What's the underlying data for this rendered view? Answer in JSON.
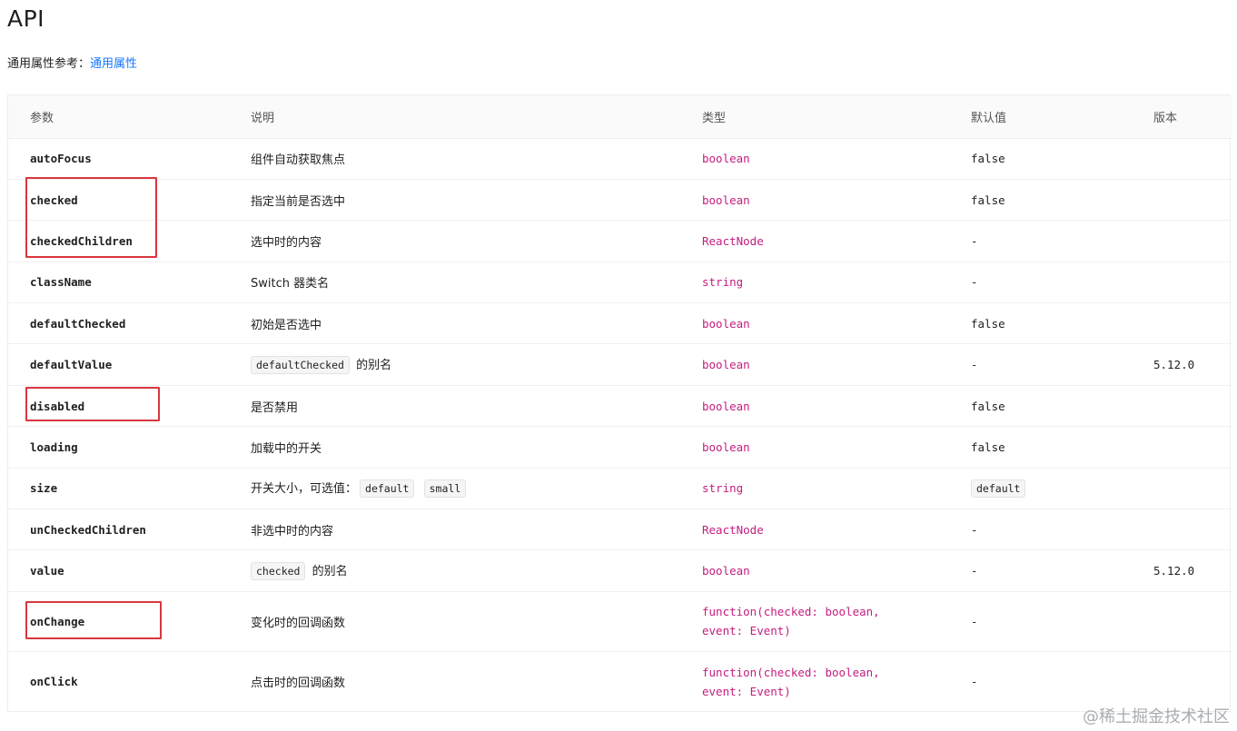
{
  "page": {
    "title": "API",
    "common_ref_prefix": "通用属性参考：",
    "common_ref_link": "通用属性",
    "watermark": "@稀土掘金技术社区"
  },
  "table": {
    "headers": {
      "param": "参数",
      "desc": "说明",
      "type": "类型",
      "default": "默认值",
      "version": "版本"
    },
    "rows": [
      {
        "param": "autoFocus",
        "desc": "组件自动获取焦点",
        "type": "boolean",
        "default": "false",
        "version": ""
      },
      {
        "param": "checked",
        "desc": "指定当前是否选中",
        "type": "boolean",
        "default": "false",
        "version": ""
      },
      {
        "param": "checkedChildren",
        "desc": "选中时的内容",
        "type": "ReactNode",
        "default": "-",
        "version": ""
      },
      {
        "param": "className",
        "desc": "Switch 器类名",
        "type": "string",
        "default": "-",
        "version": ""
      },
      {
        "param": "defaultChecked",
        "desc": "初始是否选中",
        "type": "boolean",
        "default": "false",
        "version": ""
      },
      {
        "param": "defaultValue",
        "desc_code": "defaultChecked",
        "desc_suffix": "的别名",
        "type": "boolean",
        "default": "-",
        "version": "5.12.0"
      },
      {
        "param": "disabled",
        "desc": "是否禁用",
        "type": "boolean",
        "default": "false",
        "version": ""
      },
      {
        "param": "loading",
        "desc": "加载中的开关",
        "type": "boolean",
        "default": "false",
        "version": ""
      },
      {
        "param": "size",
        "desc_prefix": "开关大小，可选值：",
        "desc_code_1": "default",
        "desc_code_2": "small",
        "type": "string",
        "default_code": "default",
        "version": ""
      },
      {
        "param": "unCheckedChildren",
        "desc": "非选中时的内容",
        "type": "ReactNode",
        "default": "-",
        "version": ""
      },
      {
        "param": "value",
        "desc_code": "checked",
        "desc_suffix": "的别名",
        "type": "boolean",
        "default": "-",
        "version": "5.12.0"
      },
      {
        "param": "onChange",
        "desc": "变化时的回调函数",
        "type_line_1": "function(checked: boolean,",
        "type_line_2": "event: Event)",
        "default": "-",
        "version": ""
      },
      {
        "param": "onClick",
        "desc": "点击时的回调函数",
        "type_line_1": "function(checked: boolean,",
        "type_line_2": "event: Event)",
        "default": "-",
        "version": ""
      }
    ]
  }
}
